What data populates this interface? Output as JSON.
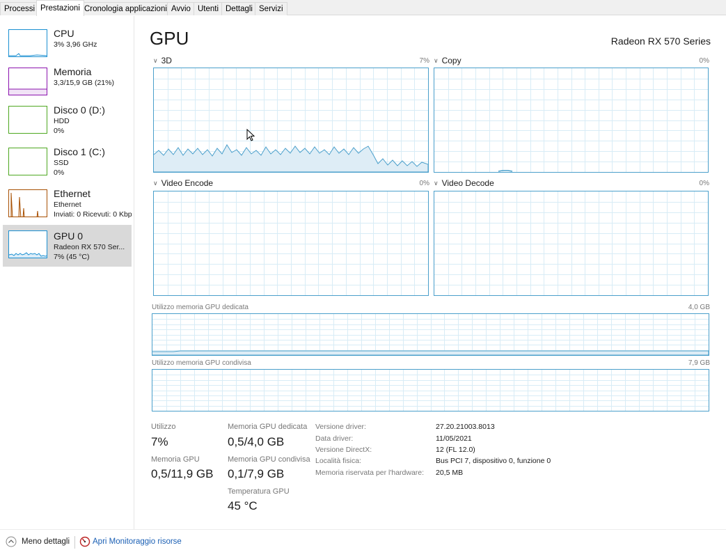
{
  "tabs": [
    "Processi",
    "Prestazioni",
    "Cronologia applicazioni",
    "Avvio",
    "Utenti",
    "Dettagli",
    "Servizi"
  ],
  "active_tab": "Prestazioni",
  "sidebar": {
    "items": [
      {
        "title": "CPU",
        "line1": "3% 3,96 GHz",
        "line2": ""
      },
      {
        "title": "Memoria",
        "line1": "3,3/15,9 GB (21%)",
        "line2": ""
      },
      {
        "title": "Disco 0 (D:)",
        "line1": "HDD",
        "line2": "0%"
      },
      {
        "title": "Disco 1 (C:)",
        "line1": "SSD",
        "line2": "0%"
      },
      {
        "title": "Ethernet",
        "line1": "Ethernet",
        "line2": "Inviati: 0 Ricevuti: 0 Kbps"
      },
      {
        "title": "GPU 0",
        "line1": "Radeon RX 570 Ser...",
        "line2": "7% (45 °C)"
      }
    ]
  },
  "header": {
    "title": "GPU",
    "model": "Radeon RX 570 Series"
  },
  "engines": [
    {
      "name": "3D",
      "percent": "7%"
    },
    {
      "name": "Copy",
      "percent": "0%"
    },
    {
      "name": "Video Encode",
      "percent": "0%"
    },
    {
      "name": "Video Decode",
      "percent": "0%"
    }
  ],
  "memory_graphs": [
    {
      "label": "Utilizzo memoria GPU dedicata",
      "max": "4,0 GB"
    },
    {
      "label": "Utilizzo memoria GPU condivisa",
      "max": "7,9 GB"
    }
  ],
  "stats": {
    "utilization_label": "Utilizzo",
    "utilization": "7%",
    "gpu_memory_label": "Memoria GPU",
    "gpu_memory": "0,5/11,9 GB",
    "dedicated_label": "Memoria GPU dedicata",
    "dedicated": "0,5/4,0 GB",
    "shared_label": "Memoria GPU condivisa",
    "shared": "0,1/7,9 GB",
    "temperature_label": "Temperatura GPU",
    "temperature": "45 °C"
  },
  "info": [
    {
      "key": "Versione driver:",
      "value": "27.20.21003.8013"
    },
    {
      "key": "Data driver:",
      "value": "11/05/2021"
    },
    {
      "key": "Versione DirectX:",
      "value": "12 (FL 12.0)"
    },
    {
      "key": "Località fisica:",
      "value": "Bus PCI 7, dispositivo 0, funzione 0"
    },
    {
      "key": "Memoria riservata per l'hardware:",
      "value": "20,5 MB"
    }
  ],
  "footer": {
    "less_details": "Meno dettagli",
    "resource_monitor": "Apri Monitoraggio risorse"
  },
  "colors": {
    "cpu": "#1a8fd1",
    "memory": "#8b12ae",
    "disk": "#4da71f",
    "ethernet": "#a74f01",
    "gpu": "#1a8fd1",
    "graph_border": "#4a9fcb",
    "grid": "#d8ecf6"
  }
}
